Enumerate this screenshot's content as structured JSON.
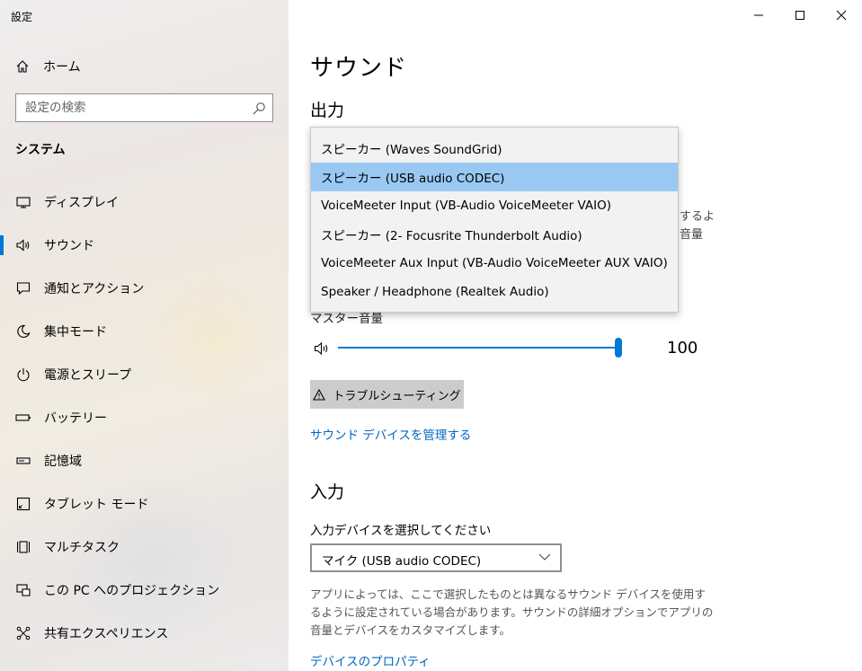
{
  "window": {
    "title": "設定"
  },
  "sidebar": {
    "home_label": "ホーム",
    "search_placeholder": "設定の検索",
    "section_title": "システム",
    "items": [
      {
        "label": "ディスプレイ",
        "icon": "monitor-icon"
      },
      {
        "label": "サウンド",
        "icon": "speaker-icon",
        "active": true
      },
      {
        "label": "通知とアクション",
        "icon": "notification-icon"
      },
      {
        "label": "集中モード",
        "icon": "moon-icon"
      },
      {
        "label": "電源とスリープ",
        "icon": "power-icon"
      },
      {
        "label": "バッテリー",
        "icon": "battery-icon"
      },
      {
        "label": "記憶域",
        "icon": "storage-icon"
      },
      {
        "label": "タブレット モード",
        "icon": "tablet-icon"
      },
      {
        "label": "マルチタスク",
        "icon": "multitask-icon"
      },
      {
        "label": "この PC へのプロジェクション",
        "icon": "projection-icon"
      },
      {
        "label": "共有エクスペリエンス",
        "icon": "share-icon"
      }
    ]
  },
  "main": {
    "title": "サウンド",
    "output": {
      "heading": "出力",
      "dropdown_options": [
        "スピーカー (Waves SoundGrid)",
        "スピーカー (USB audio CODEC)",
        "VoiceMeeter Input (VB-Audio VoiceMeeter VAIO)",
        "スピーカー (2- Focusrite Thunderbolt Audio)",
        "VoiceMeeter Aux Input (VB-Audio VoiceMeeter AUX VAIO)",
        "Speaker / Headphone (Realtek Audio)"
      ],
      "selected_index": 1,
      "hidden_text_fragment_1": "するよ",
      "hidden_text_fragment_2": "音量",
      "master_volume_label": "マスター音量",
      "volume_value": "100",
      "volume_fraction": 1.0,
      "troubleshoot_label": "トラブルシューティング",
      "manage_devices_link": "サウンド デバイスを管理する"
    },
    "input": {
      "heading": "入力",
      "select_label": "入力デバイスを選択してください",
      "selected_device": "マイク (USB audio CODEC)",
      "description": "アプリによっては、ここで選択したものとは異なるサウンド デバイスを使用するように設定されている場合があります。サウンドの詳細オプションでアプリの音量とデバイスをカスタマイズします。",
      "properties_link": "デバイスのプロパティ"
    }
  },
  "colors": {
    "accent": "#0078d7",
    "link": "#0067c0",
    "selected": "#99c9f2"
  }
}
